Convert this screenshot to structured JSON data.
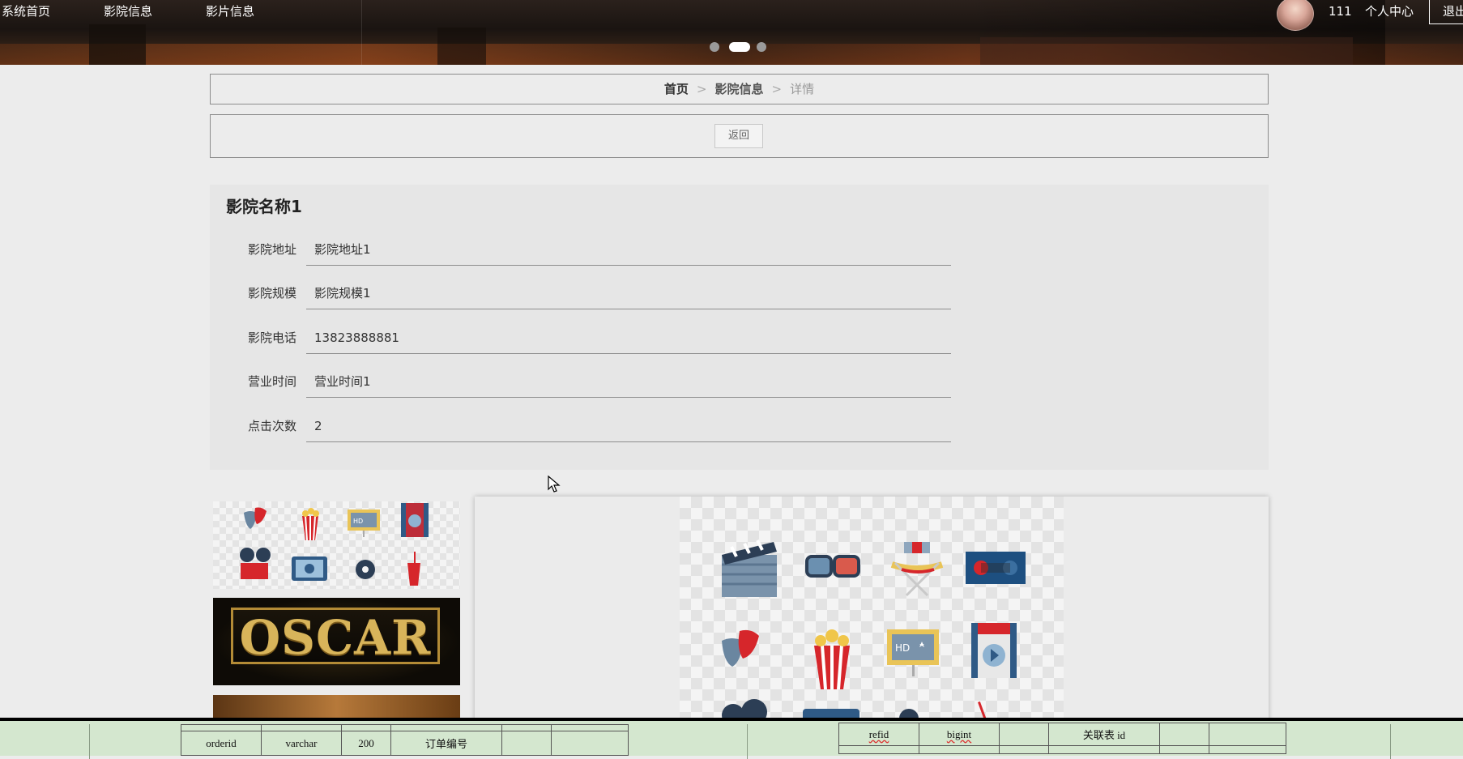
{
  "nav": {
    "items": [
      "系统首页",
      "影院信息",
      "影片信息"
    ],
    "user_name": "111",
    "user_center": "个人中心",
    "logout": "退出"
  },
  "breadcrumb": {
    "home": "首页",
    "separator": ">",
    "current": "影院信息",
    "detail": "详情"
  },
  "back_label": "返回",
  "cinema": {
    "title": "影院名称1",
    "fields": [
      {
        "label": "影院地址",
        "value": "影院地址1"
      },
      {
        "label": "影院规模",
        "value": "影院规模1"
      },
      {
        "label": "影院电话",
        "value": "13823888881"
      },
      {
        "label": "营业时间",
        "value": "营业时间1"
      },
      {
        "label": "点击次数",
        "value": "2"
      }
    ]
  },
  "gallery": {
    "oscar_text": "OSCAR",
    "carousel_active_index": 1,
    "carousel_count": 3
  },
  "overlay_table": {
    "row1": [
      "orderid",
      "varchar",
      "200",
      "订单编号"
    ],
    "row2": [
      "refid",
      "bigint",
      "关联表 id"
    ]
  },
  "colors": {
    "page_bg": "#ececec",
    "panel_bg": "#e6e6e6",
    "overlay_bg": "#d4e7cf",
    "accent_gold": "#d8b45a"
  }
}
